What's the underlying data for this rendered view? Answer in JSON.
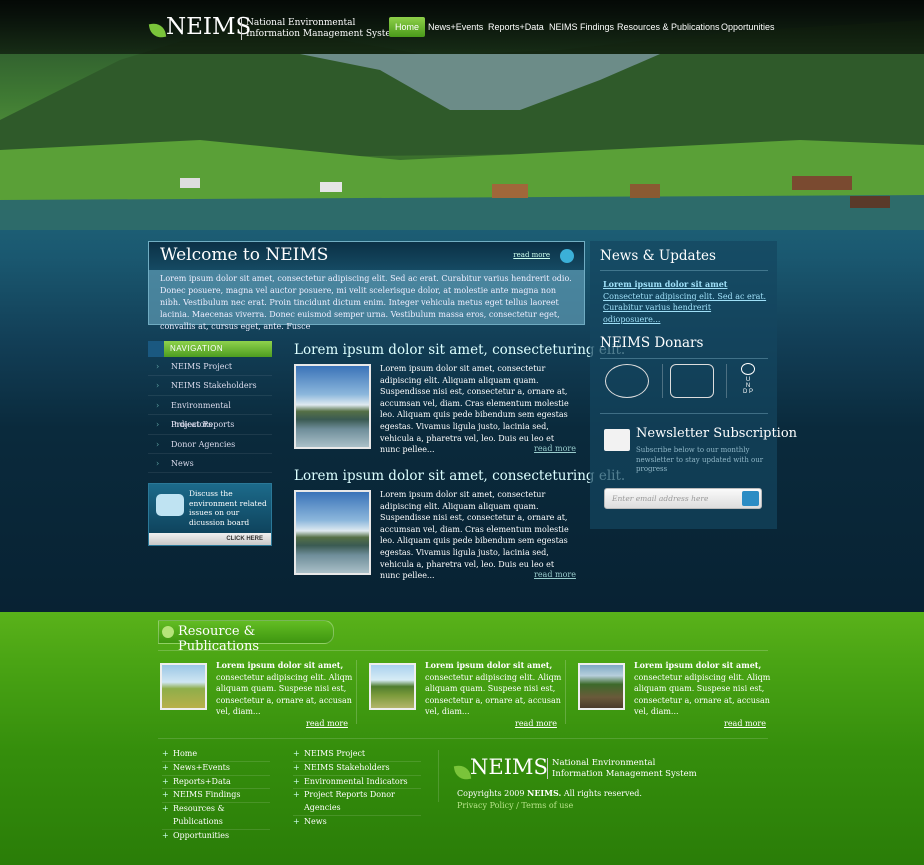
{
  "brand": {
    "name": "NEIMS",
    "subtitle_line1": "National Environmental",
    "subtitle_line2": "Information Management System"
  },
  "nav": {
    "items": [
      "Home",
      "News+Events",
      "Reports+Data",
      "NEIMS Findings",
      "Resources & Publications",
      "Opportunities"
    ],
    "active": "Home"
  },
  "welcome": {
    "title": "Welcome to NEIMS",
    "read_more": "read more",
    "body": "Lorem ipsum dolor sit amet, consectetur adipiscing elit. Sed ac erat. Curabitur varius hendrerit odio. Donec posuere, magna vel auctor posuere, mi velit scelerisque dolor, at molestie ante magna non nibh. Vestibulum nec erat. Proin tincidunt dictum enim. Integer vehicula metus eget tellus laoreet lacinia. Maecenas viverra. Donec euismod semper urna. Vestibulum massa eros, consectetur eget, convallis at, cursus eget, ante. Fusce"
  },
  "sidebar": {
    "heading": "NAVIGATION",
    "items": [
      "NEIMS Project",
      "NEIMS Stakeholders",
      "Environmental Indicators",
      "Project Reports",
      "Donor Agencies",
      "News"
    ]
  },
  "discuss": {
    "text": "Discuss the environment related issues on our dicussion board",
    "button": "CLICK HERE"
  },
  "articles": [
    {
      "title": "Lorem ipsum dolor sit amet, consecteturing elit.",
      "body": "Lorem ipsum dolor sit amet, consectetur adipiscing elit. Aliquam aliquam quam. Suspendisse nisi est, consectetur a, ornare at, accumsan vel, diam. Cras elementum molestie leo. Aliquam quis pede bibendum sem egestas egestas. Vivamus ligula justo, lacinia sed, vehicula a, pharetra vel, leo. Duis eu leo et nunc pellee...",
      "read_more": "read more"
    },
    {
      "title": "Lorem ipsum dolor sit amet, consecteturing elit.",
      "body": "Lorem ipsum dolor sit amet, consectetur adipiscing elit. Aliquam aliquam quam. Suspendisse nisi est, consectetur a, ornare at, accumsan vel, diam. Cras elementum molestie leo. Aliquam quis pede bibendum sem egestas egestas. Vivamus ligula justo, lacinia sed, vehicula a, pharetra vel, leo. Duis eu leo et nunc pellee...",
      "read_more": "read more"
    }
  ],
  "news": {
    "title": "News & Updates",
    "link1": "Lorem ipsum dolor sit amet",
    "link2": "Consectetur adipiscing elit. Sed ac erat.",
    "link3": "Curabitur varius hendrerit odioposuere..."
  },
  "donors": {
    "title": "NEIMS Donars",
    "undp": "U N D P"
  },
  "newsletter": {
    "title": "Newsletter Subscription",
    "text": "Subscribe below to our monthly newsletter to stay updated with our progress",
    "placeholder": "Enter email address here"
  },
  "resources": {
    "title": "Resource & Publications",
    "items": [
      {
        "title": "Lorem ipsum dolor sit amet,",
        "body": "consectetur adipiscing elit. Aliqm aliquam quam. Suspese nisi est, consectetur a, ornare at, accusan vel, diam...",
        "read_more": "read more"
      },
      {
        "title": "Lorem ipsum dolor sit amet,",
        "body": "consectetur adipiscing elit. Aliqm aliquam quam. Suspese nisi est, consectetur a, ornare at, accusan vel, diam...",
        "read_more": "read more"
      },
      {
        "title": "Lorem ipsum dolor sit amet,",
        "body": "consectetur adipiscing elit. Aliqm aliquam quam. Suspese nisi est, consectetur a, ornare at, accusan vel, diam...",
        "read_more": "read more"
      }
    ]
  },
  "footer": {
    "col1": [
      "Home",
      "News+Events",
      "Reports+Data",
      "NEIMS Findings",
      "Resources & Publications",
      "Opportunities"
    ],
    "col2": [
      "NEIMS Project",
      "NEIMS Stakeholders",
      "Environmental Indicators",
      "Project Reports Donor Agencies",
      "News"
    ],
    "copyright_pre": "Copyrights 2009",
    "copyright_brand": "NEIMS.",
    "copyright_post": "All rights reserved.",
    "privacy": "Privacy Policy",
    "separator": "/",
    "terms": "Terms of use"
  }
}
